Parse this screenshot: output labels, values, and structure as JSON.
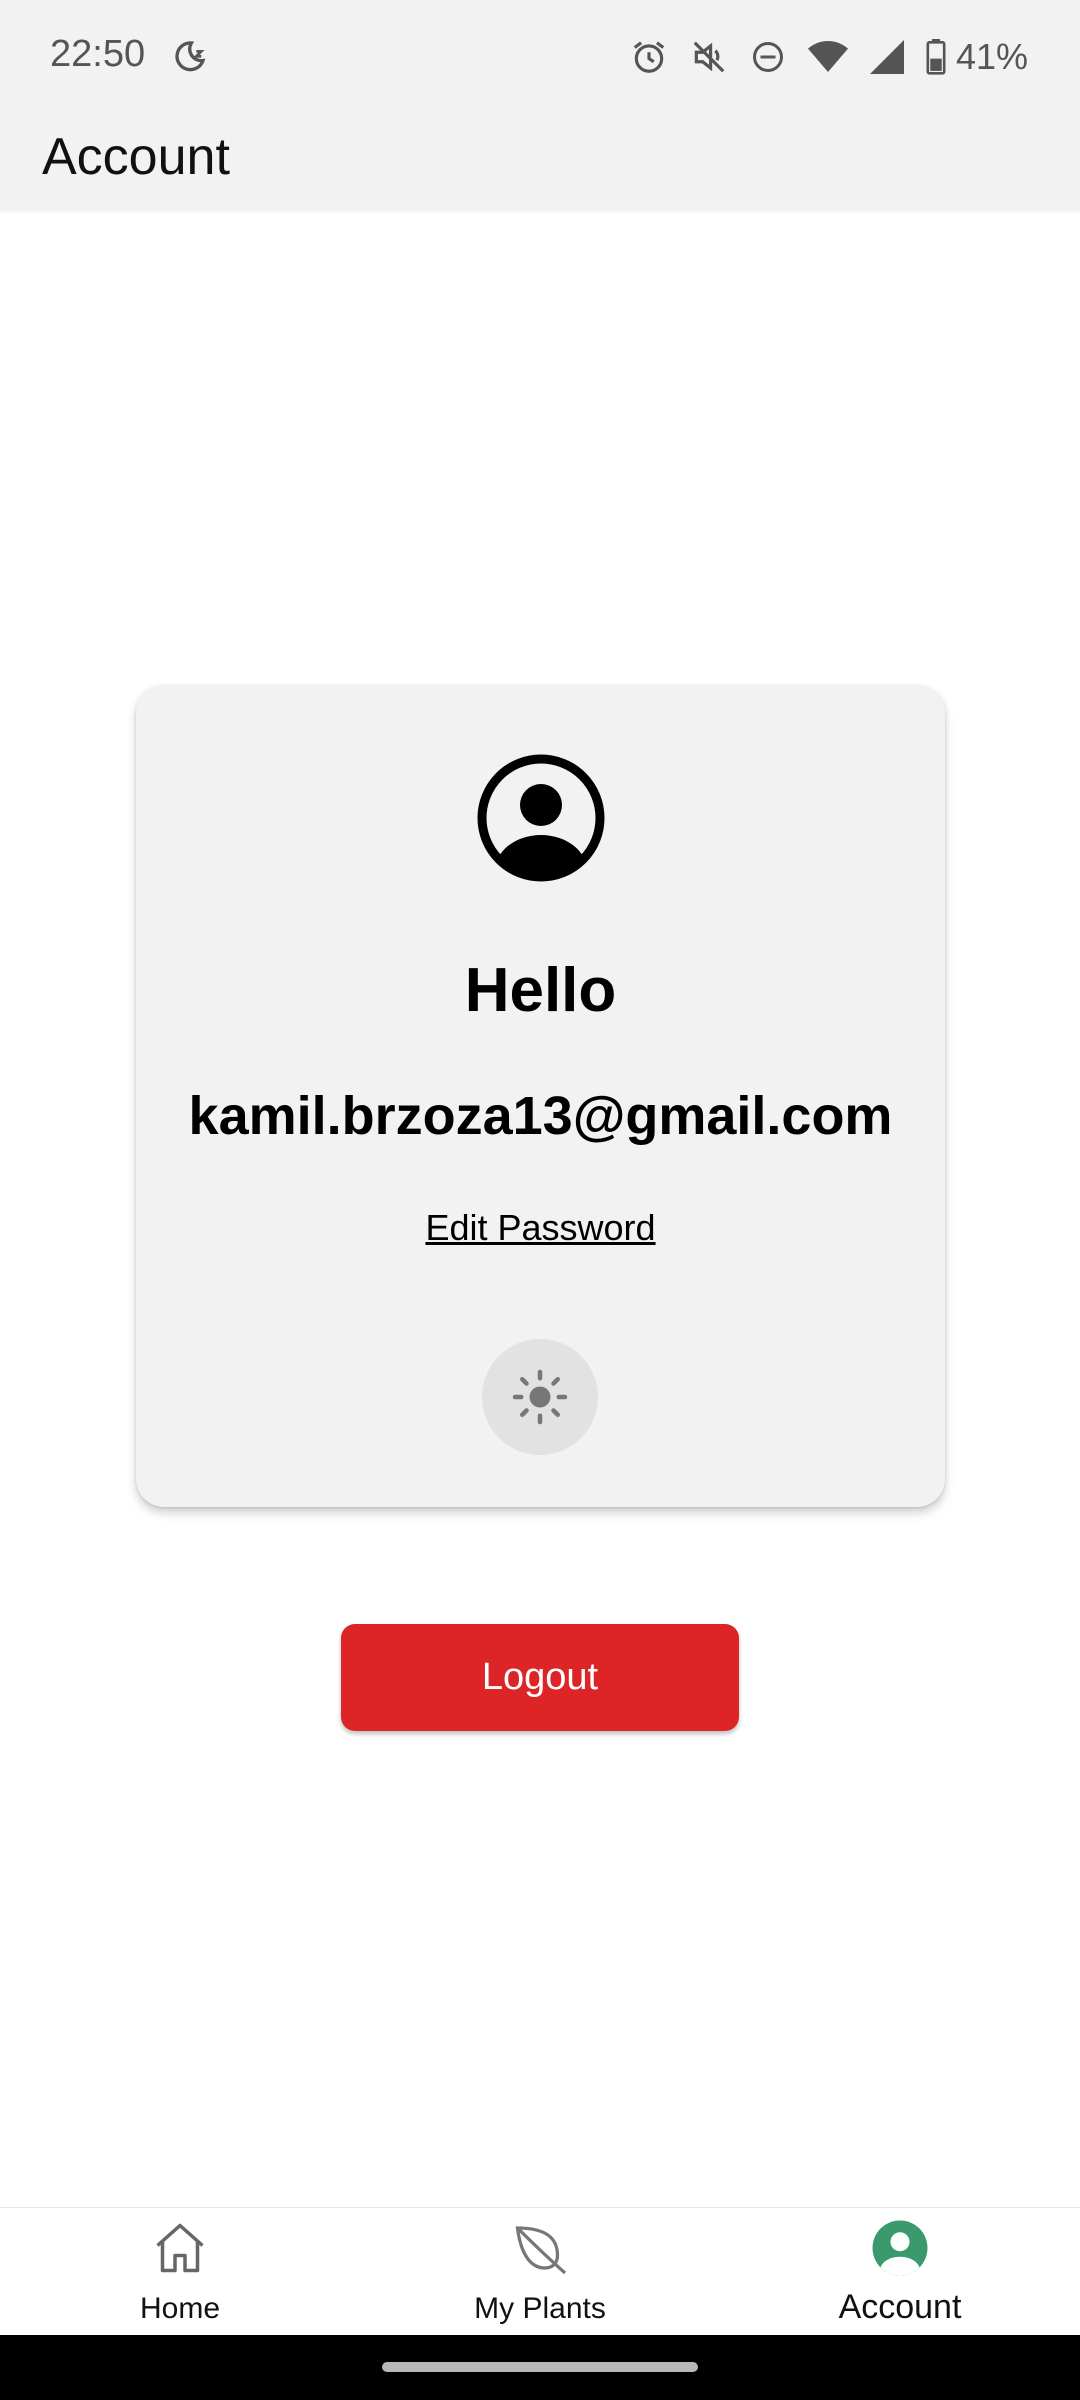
{
  "status_bar": {
    "time": "22:50",
    "battery_percent": "41%",
    "icons": [
      "moon-icon",
      "alarm-icon",
      "mute-icon",
      "do-not-disturb-icon",
      "wifi-icon",
      "signal-icon",
      "battery-icon"
    ]
  },
  "app_bar": {
    "title": "Account"
  },
  "profile_card": {
    "greeting": "Hello",
    "email": "kamil.brzoza13@gmail.com",
    "edit_password_label": "Edit Password",
    "theme_toggle_icon": "sun-icon"
  },
  "logout": {
    "label": "Logout",
    "color": "#dd2427"
  },
  "bottom_nav": {
    "items": [
      {
        "label": "Home",
        "icon": "home-icon",
        "active": false
      },
      {
        "label": "My Plants",
        "icon": "leaf-icon",
        "active": false
      },
      {
        "label": "Account",
        "icon": "account-icon",
        "active": true
      }
    ],
    "active_color": "#3a9a6e"
  }
}
